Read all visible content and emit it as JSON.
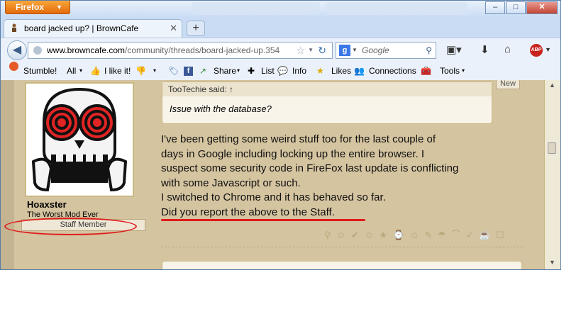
{
  "browser": {
    "app_button": "Firefox",
    "tab_title": "board jacked up? | BrownCafe",
    "new_tab_label": "+",
    "window_controls": {
      "minimize": "–",
      "maximize": "□",
      "close": "✕"
    }
  },
  "navbar": {
    "back_icon": "back-arrow-icon",
    "url_host": "www.browncafe.com",
    "url_path": "/community/threads/board-jacked-up.354",
    "search_placeholder": "Google",
    "search_engine_letter": "g",
    "icons": [
      "bookmarks-icon",
      "download-icon",
      "home-icon",
      "adblock-icon"
    ],
    "adblock_label": "ABP"
  },
  "stumblebar": {
    "stumble_label": "Stumble!",
    "all_label": "All",
    "ilike_label": "I like it!",
    "share_label": "Share",
    "list_label": "List",
    "info_label": "Info",
    "likes_label": "Likes",
    "connections_label": "Connections",
    "tools_label": "Tools"
  },
  "post": {
    "username": "Hoaxster",
    "user_title": "The Worst Mod Ever",
    "badge": "Staff Member",
    "new_badge": "New",
    "quote_author": "TooTechie said: ↑",
    "quote_text": "Issue with the database?",
    "message_lines": [
      "I've been getting some weird stuff too for the last couple of",
      "days in Google including locking up the entire browser. I",
      "suspect some security code in FireFox last update is conflicting",
      "with some Javascript or such.",
      "I switched to Chrome and it has behaved so far.",
      "Did you report the above to the Staff."
    ],
    "reaction_icons": "⚲ ☺ ✔ ☺ ★ ⌚ ☺ ✎ ☂ ⌒ ✓ ☕ ☐"
  },
  "colors": {
    "accent_red": "#e01b1b",
    "forum_bg": "#d4c4a0",
    "firefox_orange": "#e56b0c"
  }
}
